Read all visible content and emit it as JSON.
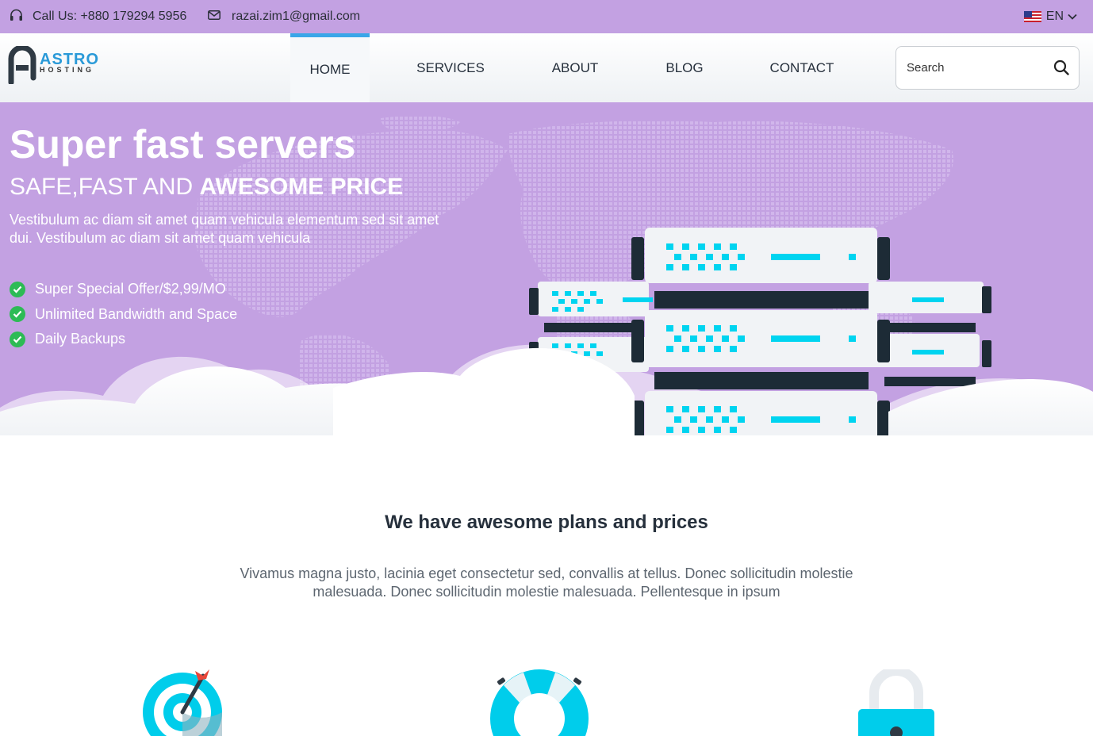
{
  "topbar": {
    "phone": "Call Us: +880 179294 5956",
    "email": "razai.zim1@gmail.com",
    "language": "EN"
  },
  "header": {
    "logo_main": "ASTRO",
    "logo_sub": "HOSTING",
    "nav": [
      {
        "label": "HOME"
      },
      {
        "label": "SERVICES"
      },
      {
        "label": "ABOUT"
      },
      {
        "label": "BLOG"
      },
      {
        "label": "CONTACT"
      }
    ],
    "search_placeholder": "Search"
  },
  "hero": {
    "title_bold": "Super fast",
    "title_rest": " servers",
    "subtitle_normal": "SAFE,FAST AND ",
    "subtitle_bold": "AWESOME PRICE",
    "description": "Vestibulum ac diam sit amet quam vehicula elementum sed sit amet dui. Vestibulum ac diam sit amet quam vehicula",
    "features": [
      "Super Special Offer/$2,99/MO",
      "Unlimited Bandwidth and Space",
      "Daily Backups"
    ]
  },
  "plans": {
    "title": "We have awesome plans and prices",
    "description": "Vivamus magna justo, lacinia eget consectetur sed, convallis at tellus. Donec sollicitudin molestie malesuada. Donec sollicitudin molestie malesuada. Pellentesque in ipsum"
  },
  "colors": {
    "purple": "#c3a1e2",
    "accent_blue": "#3aa6e8",
    "cyan": "#00d4f0",
    "green": "#2dbb55"
  },
  "icons": [
    "headphones-icon",
    "envelope-icon",
    "us-flag-icon",
    "chevron-down-icon",
    "search-icon",
    "check-circle-icon",
    "target-icon",
    "lifebuoy-icon",
    "lock-icon"
  ]
}
